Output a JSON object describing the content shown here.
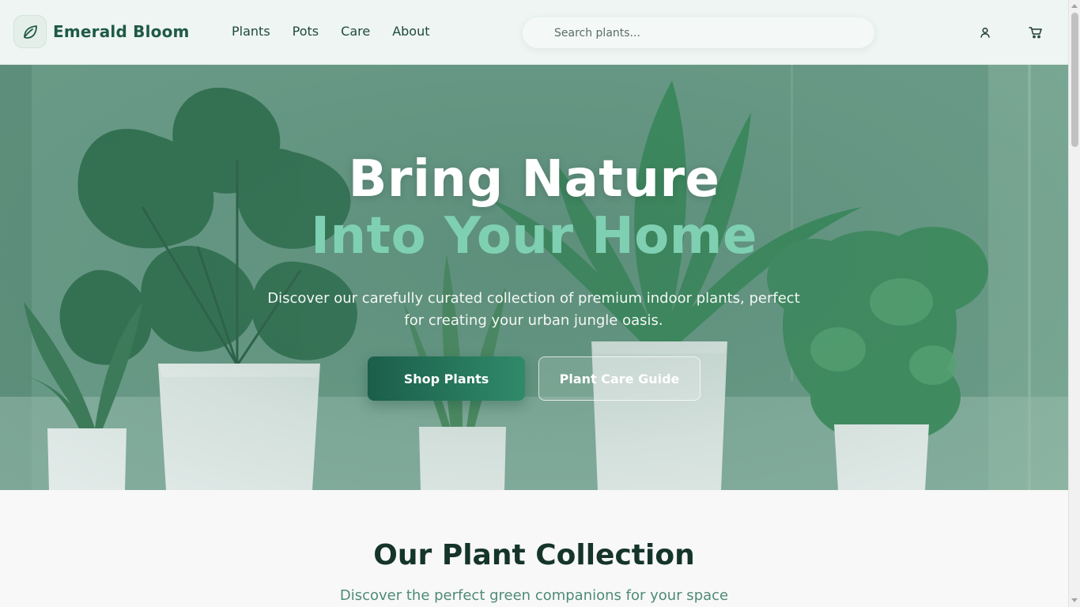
{
  "header": {
    "brand": "Emerald Bloom",
    "logo_icon": "leaf-icon",
    "nav": [
      {
        "label": "Plants"
      },
      {
        "label": "Pots"
      },
      {
        "label": "Care"
      },
      {
        "label": "About"
      }
    ],
    "search": {
      "placeholder": "Search plants...",
      "value": ""
    },
    "account_icon": "user-icon",
    "cart_icon": "cart-icon"
  },
  "hero": {
    "title_line1": "Bring Nature",
    "title_line2": "Into Your Home",
    "subtitle": "Discover our carefully curated collection of premium indoor plants, perfect for creating your urban jungle oasis.",
    "primary_button": "Shop Plants",
    "secondary_button": "Plant Care Guide"
  },
  "collection": {
    "title": "Our Plant Collection",
    "subtitle": "Discover the perfect green companions for your space"
  },
  "colors": {
    "brand": "#1f5a45",
    "accent": "#7fd0b2",
    "primary_button_start": "#1b5e4a",
    "primary_button_end": "#2f8a6a",
    "header_bg": "#eef5f2"
  }
}
